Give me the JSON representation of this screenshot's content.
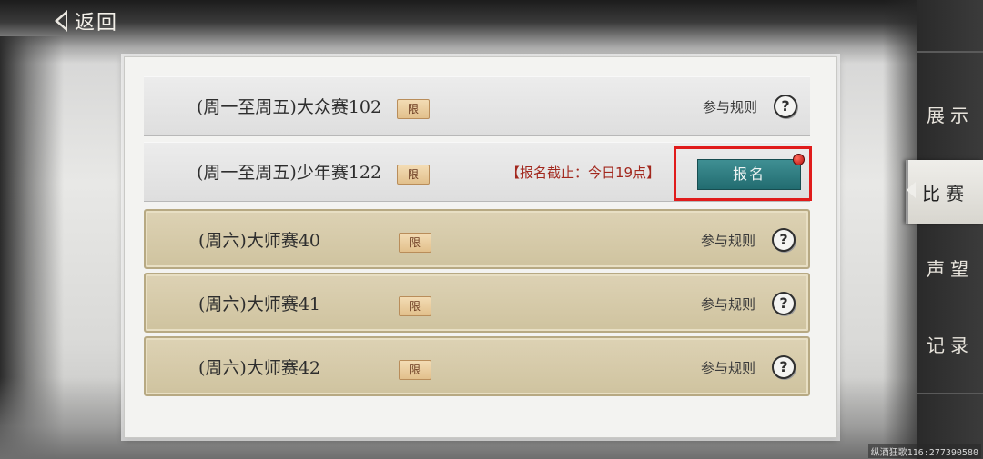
{
  "header": {
    "back_label": "返回"
  },
  "matches": [
    {
      "name": "(周一至周五)大众赛102",
      "badge": "限",
      "rules_label": "参与规则",
      "help_icon": "?"
    },
    {
      "name": "(周一至周五)少年赛122",
      "badge": "限",
      "deadline": "【报名截止：今日19点】",
      "signup_label": "报名"
    },
    {
      "name": "(周六)大师赛40",
      "badge": "限",
      "rules_label": "参与规则",
      "help_icon": "?"
    },
    {
      "name": "(周六)大师赛41",
      "badge": "限",
      "rules_label": "参与规则",
      "help_icon": "?"
    },
    {
      "name": "(周六)大师赛42",
      "badge": "限",
      "rules_label": "参与规则",
      "help_icon": "?"
    }
  ],
  "sidebar": {
    "tabs": [
      {
        "label": "展示",
        "active": false
      },
      {
        "label": "比赛",
        "active": true
      },
      {
        "label": "声望",
        "active": false
      },
      {
        "label": "记录",
        "active": false
      }
    ]
  },
  "footer": {
    "player_id": "纵酒狂歌116:277390580"
  },
  "colors": {
    "accent_teal": "#2b7a7e",
    "deadline_red": "#a2281e",
    "highlight_red": "#e01b1b",
    "tan_row": "#d6caa8"
  }
}
